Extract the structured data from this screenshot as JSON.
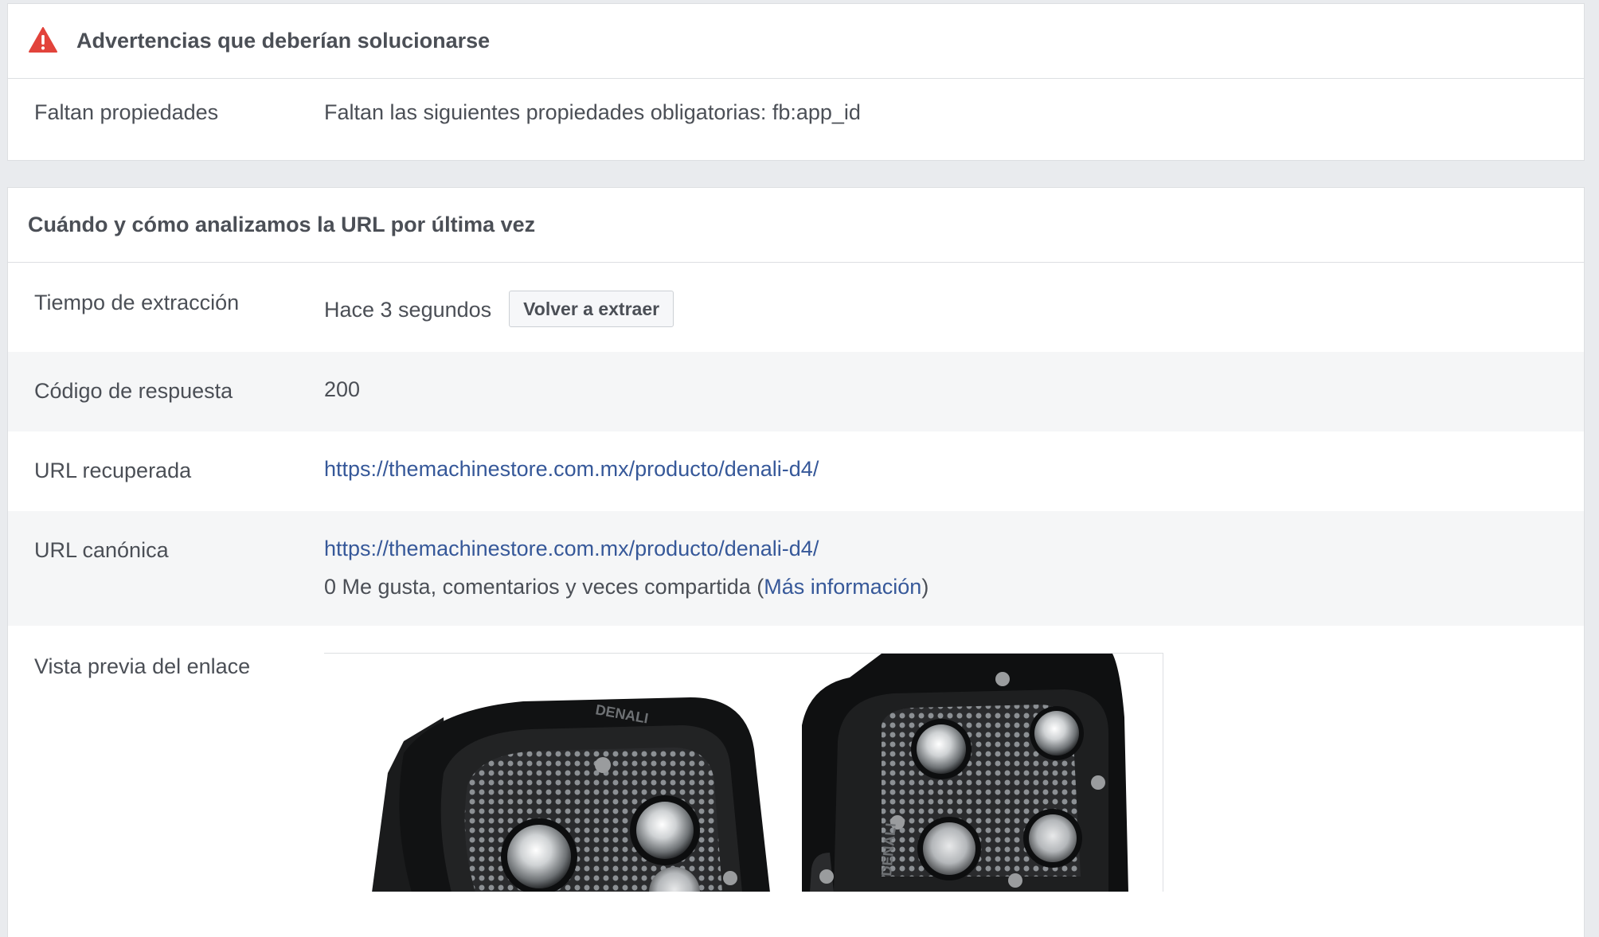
{
  "warnings": {
    "title": "Advertencias que deberían solucionarse",
    "icon": "warning-triangle-icon",
    "icon_color": "#e2433b",
    "rows": [
      {
        "label": "Faltan propiedades",
        "value": "Faltan las siguientes propiedades obligatorias: fb:app_id"
      }
    ]
  },
  "scrape": {
    "title": "Cuándo y cómo analizamos la URL por última vez",
    "fetch_time": {
      "label": "Tiempo de extracción",
      "value": "Hace 3 segundos",
      "button_label": "Volver a extraer"
    },
    "response_code": {
      "label": "Código de respuesta",
      "value": "200"
    },
    "fetched_url": {
      "label": "URL recuperada",
      "value": "https://themachinestore.com.mx/producto/denali-d4/"
    },
    "canonical_url": {
      "label": "URL canónica",
      "value": "https://themachinestore.com.mx/producto/denali-d4/",
      "engagement_prefix": "0 Me gusta, comentarios y veces compartida (",
      "engagement_link": "Más información",
      "engagement_suffix": ")"
    },
    "link_preview": {
      "label": "Vista previa del enlace",
      "product_brand": "DENALI"
    }
  },
  "colors": {
    "link": "#365899",
    "page_bg": "#e9ebee",
    "alt_row": "#f5f6f7"
  }
}
